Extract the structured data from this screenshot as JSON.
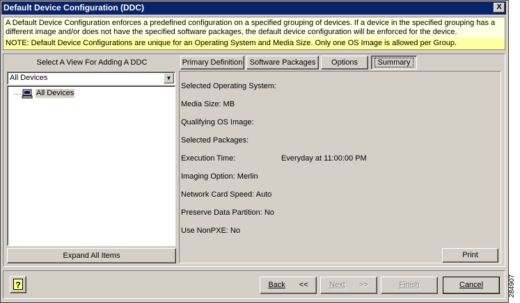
{
  "window": {
    "title": "Default Device Configuration (DDC)",
    "close_label": "X"
  },
  "banner": {
    "description": "A Default Device Configuration enforces a predefined configuration on a specified grouping of devices.  If a device in the specified grouping has a different image and/or does not have the specified software packages, the default device configuration will be enforced for the device.",
    "note": "NOTE: Default Device Configurations are unique for an Operating System and Media Size.  Only one OS Image is allowed per Group."
  },
  "left_panel": {
    "view_label": "Select A View For Adding A DDC",
    "dropdown_value": "All Devices",
    "tree_items": [
      {
        "label": "All Devices",
        "icon": "computer-icon",
        "selected": true
      }
    ],
    "expand_label": "Expand All Items"
  },
  "tabs": [
    {
      "label": "Primary Definition",
      "active": false
    },
    {
      "label": "Software Packages",
      "active": false
    },
    {
      "label": "Options",
      "active": false
    },
    {
      "label": "Summary",
      "active": true
    }
  ],
  "summary": {
    "os": "Selected Operating System:",
    "media_size": "Media Size: MB",
    "qualifying_image": "Qualifying OS Image:",
    "packages": "Selected Packages:",
    "execution_label": "Execution Time:",
    "execution_value": "Everyday at  11:00:00 PM",
    "imaging_option": "Imaging Option: Merlin",
    "network_speed": "Network Card Speed: Auto",
    "preserve_partition": "Preserve Data Partition: No",
    "use_nonpxe": "Use NonPXE: No"
  },
  "buttons": {
    "print": "Print",
    "help": "?",
    "back": "Back",
    "back_chevron": "<<",
    "next": "Next",
    "next_chevron": ">>",
    "finish": "Finish",
    "cancel": "Cancel"
  },
  "watermark": "284907",
  "colors": {
    "titlebar": "#0a246a",
    "dialog_bg": "#d4d0c8",
    "description_bg": "#ffffe1",
    "note_bg": "#ffffa0"
  }
}
